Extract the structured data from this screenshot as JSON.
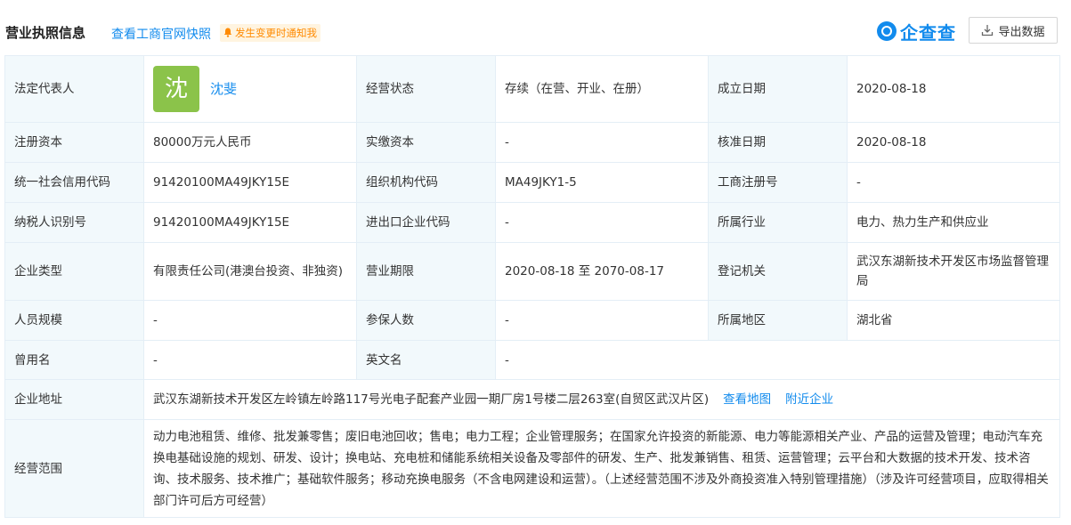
{
  "header": {
    "title": "营业执照信息",
    "snapshot_link": "查看工商官网快照",
    "notify_badge": "发生变更时通知我",
    "brand_name": "企查查",
    "export_label": "导出数据"
  },
  "colors": {
    "accent": "#128bed",
    "label_bg": "#f2f9fc",
    "avatar_bg": "#8bc34a",
    "badge_text": "#ff8a00"
  },
  "info": {
    "legal_rep_label": "法定代表人",
    "legal_rep_avatar": "沈",
    "legal_rep_name": "沈斐",
    "status_label": "经营状态",
    "status_value": "存续（在营、开业、在册）",
    "founded_label": "成立日期",
    "founded_value": "2020-08-18",
    "reg_capital_label": "注册资本",
    "reg_capital_value": "80000万元人民币",
    "paid_capital_label": "实缴资本",
    "paid_capital_value": "-",
    "approve_date_label": "核准日期",
    "approve_date_value": "2020-08-18",
    "credit_code_label": "统一社会信用代码",
    "credit_code_value": "91420100MA49JKY15E",
    "org_code_label": "组织机构代码",
    "org_code_value": "MA49JKY1-5",
    "reg_no_label": "工商注册号",
    "reg_no_value": "-",
    "taxpayer_label": "纳税人识别号",
    "taxpayer_value": "91420100MA49JKY15E",
    "import_export_label": "进出口企业代码",
    "import_export_value": "-",
    "industry_label": "所属行业",
    "industry_value": "电力、热力生产和供应业",
    "company_type_label": "企业类型",
    "company_type_value": "有限责任公司(港澳台投资、非独资)",
    "term_label": "营业期限",
    "term_value": "2020-08-18 至 2070-08-17",
    "authority_label": "登记机关",
    "authority_value": "武汉东湖新技术开发区市场监督管理局",
    "staff_label": "人员规模",
    "staff_value": "-",
    "insured_label": "参保人数",
    "insured_value": "-",
    "region_label": "所属地区",
    "region_value": "湖北省",
    "former_name_label": "曾用名",
    "former_name_value": "-",
    "english_name_label": "英文名",
    "english_name_value": "-",
    "address_label": "企业地址",
    "address_value": "武汉东湖新技术开发区左岭镇左岭路117号光电子配套产业园一期厂房1号楼二层263室(自贸区武汉片区)",
    "map_link": "查看地图",
    "nearby_link": "附近企业",
    "scope_label": "经营范围",
    "scope_value": "动力电池租赁、维修、批发兼零售；废旧电池回收；售电；电力工程；企业管理服务；在国家允许投资的新能源、电力等能源相关产业、产品的运营及管理；电动汽车充换电基础设施的规划、研发、设计；换电站、充电桩和储能系统相关设备及零部件的研发、生产、批发兼销售、租赁、运营管理；云平台和大数据的技术开发、技术咨询、技术服务、技术推广；基础软件服务；移动充换电服务（不含电网建设和运营）。（上述经营范围不涉及外商投资准入特别管理措施）（涉及许可经营项目，应取得相关部门许可后方可经营）"
  }
}
